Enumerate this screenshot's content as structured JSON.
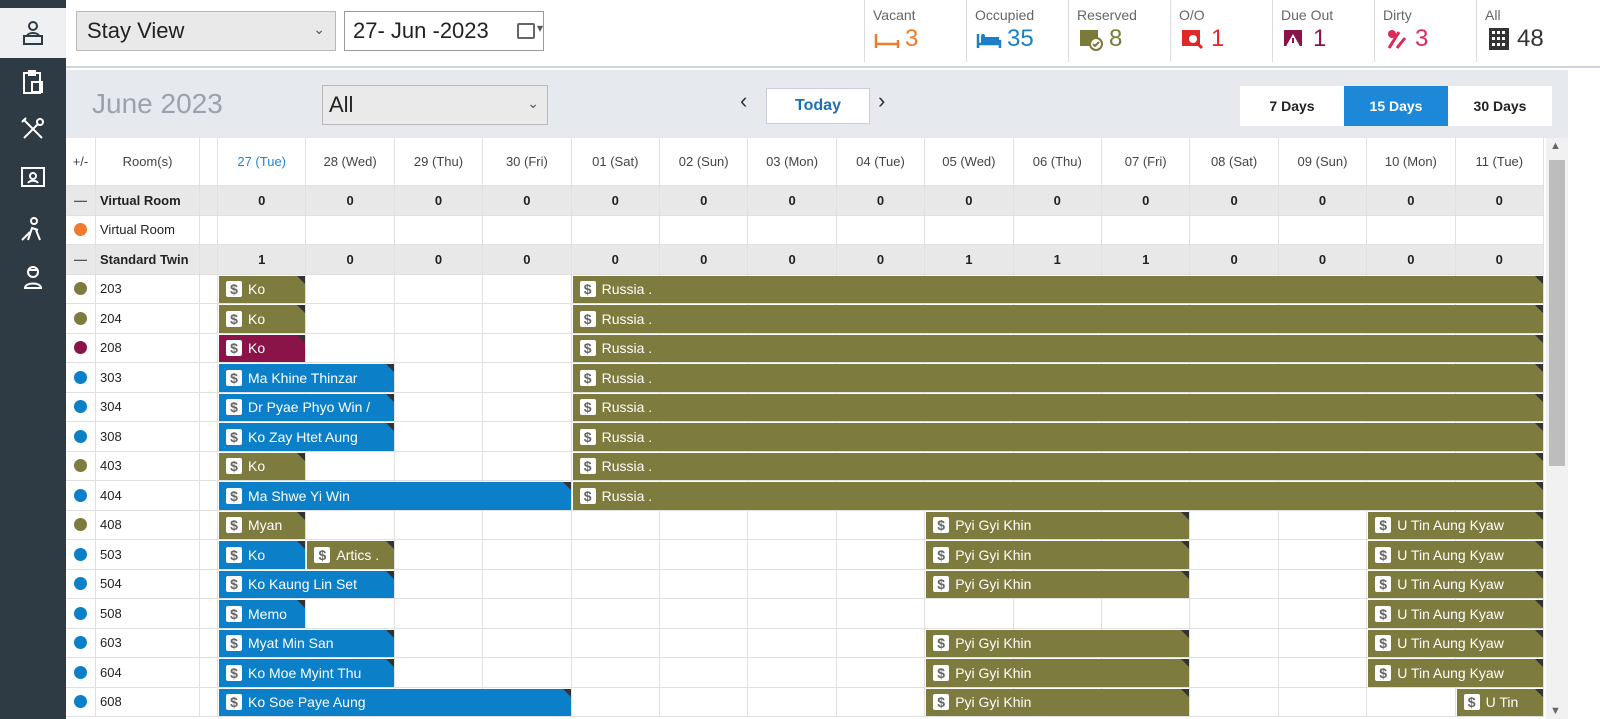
{
  "topbar": {
    "view_select": "Stay View",
    "date": "27- Jun -2023",
    "stats": [
      {
        "key": "vacant",
        "label": "Vacant",
        "value": "3",
        "color": "#f07b2e",
        "icon": "bed-empty-icon"
      },
      {
        "key": "occupied",
        "label": "Occupied",
        "value": "35",
        "color": "#1b80c8",
        "icon": "bed-occupied-icon"
      },
      {
        "key": "reserved",
        "label": "Reserved",
        "value": "8",
        "color": "#7b7a3a",
        "icon": "reserved-check-icon"
      },
      {
        "key": "oo",
        "label": "O/O",
        "value": "1",
        "color": "#e02828",
        "icon": "out-of-order-icon"
      },
      {
        "key": "dueout",
        "label": "Due Out",
        "value": "1",
        "color": "#8a1447",
        "icon": "due-out-icon"
      },
      {
        "key": "dirty",
        "label": "Dirty",
        "value": "3",
        "color": "#e02857",
        "icon": "dirty-icon"
      },
      {
        "key": "all",
        "label": "All",
        "value": "48",
        "color": "#333333",
        "icon": "building-icon"
      }
    ]
  },
  "calendar": {
    "month_label": "June 2023",
    "filter": "All",
    "today_label": "Today",
    "ranges": [
      {
        "label": "7 Days",
        "active": false
      },
      {
        "label": "15 Days",
        "active": true
      },
      {
        "label": "30 Days",
        "active": false
      }
    ]
  },
  "grid": {
    "toggle_header": "+/-",
    "rooms_header": "Room(s)",
    "days": [
      "27 (Tue)",
      "28 (Wed)",
      "29 (Thu)",
      "30 (Fri)",
      "01 (Sat)",
      "02 (Sun)",
      "03 (Mon)",
      "04 (Tue)",
      "05 (Wed)",
      "06 (Thu)",
      "07 (Fri)",
      "08 (Sat)",
      "09 (Sun)",
      "10 (Mon)",
      "11 (Tue)"
    ],
    "rows": [
      {
        "type": "group",
        "label": "Virtual Room",
        "counts": [
          "0",
          "0",
          "0",
          "0",
          "0",
          "0",
          "0",
          "0",
          "0",
          "0",
          "0",
          "0",
          "0",
          "0",
          "0"
        ]
      },
      {
        "type": "room",
        "label": "Virtual Room",
        "dot": "#f07b2e"
      },
      {
        "type": "group",
        "label": "Standard Twin",
        "counts": [
          "1",
          "0",
          "0",
          "0",
          "0",
          "0",
          "0",
          "0",
          "1",
          "1",
          "1",
          "0",
          "0",
          "0",
          "0"
        ]
      },
      {
        "type": "room",
        "label": "203",
        "dot": "#7e7b3e"
      },
      {
        "type": "room",
        "label": "204",
        "dot": "#7e7b3e"
      },
      {
        "type": "room",
        "label": "208",
        "dot": "#8a1447"
      },
      {
        "type": "room",
        "label": "303",
        "dot": "#0b7fc7"
      },
      {
        "type": "room",
        "label": "304",
        "dot": "#0b7fc7"
      },
      {
        "type": "room",
        "label": "308",
        "dot": "#0b7fc7"
      },
      {
        "type": "room",
        "label": "403",
        "dot": "#7e7b3e"
      },
      {
        "type": "room",
        "label": "404",
        "dot": "#0b7fc7"
      },
      {
        "type": "room",
        "label": "408",
        "dot": "#7e7b3e"
      },
      {
        "type": "room",
        "label": "503",
        "dot": "#0b7fc7"
      },
      {
        "type": "room",
        "label": "504",
        "dot": "#0b7fc7"
      },
      {
        "type": "room",
        "label": "508",
        "dot": "#0b7fc7"
      },
      {
        "type": "room",
        "label": "603",
        "dot": "#0b7fc7"
      },
      {
        "type": "room",
        "label": "604",
        "dot": "#0b7fc7"
      },
      {
        "type": "room",
        "label": "608",
        "dot": "#0b7fc7"
      }
    ],
    "bookings": [
      {
        "row": 3,
        "start": 0,
        "span": 1,
        "name": "Ko",
        "status": "olive"
      },
      {
        "row": 3,
        "start": 4,
        "span": 11,
        "name": "Russia .",
        "status": "olive"
      },
      {
        "row": 4,
        "start": 0,
        "span": 1,
        "name": "Ko",
        "status": "olive"
      },
      {
        "row": 4,
        "start": 4,
        "span": 11,
        "name": "Russia .",
        "status": "olive"
      },
      {
        "row": 5,
        "start": 0,
        "span": 1,
        "name": "Ko",
        "status": "maroon"
      },
      {
        "row": 5,
        "start": 4,
        "span": 11,
        "name": "Russia .",
        "status": "olive"
      },
      {
        "row": 6,
        "start": 0,
        "span": 2,
        "name": "Ma Khine Thinzar",
        "status": "blue"
      },
      {
        "row": 6,
        "start": 4,
        "span": 11,
        "name": "Russia .",
        "status": "olive"
      },
      {
        "row": 7,
        "start": 0,
        "span": 2,
        "name": "Dr Pyae Phyo Win /",
        "status": "blue"
      },
      {
        "row": 7,
        "start": 4,
        "span": 11,
        "name": "Russia .",
        "status": "olive"
      },
      {
        "row": 8,
        "start": 0,
        "span": 2,
        "name": "Ko Zay Htet Aung",
        "status": "blue"
      },
      {
        "row": 8,
        "start": 4,
        "span": 11,
        "name": "Russia .",
        "status": "olive"
      },
      {
        "row": 9,
        "start": 0,
        "span": 1,
        "name": "Ko",
        "status": "olive"
      },
      {
        "row": 9,
        "start": 4,
        "span": 11,
        "name": "Russia .",
        "status": "olive"
      },
      {
        "row": 10,
        "start": 0,
        "span": 4,
        "name": "Ma Shwe Yi Win",
        "status": "blue"
      },
      {
        "row": 10,
        "start": 4,
        "span": 11,
        "name": "Russia .",
        "status": "olive"
      },
      {
        "row": 11,
        "start": 0,
        "span": 1,
        "name": "Myan",
        "status": "olive"
      },
      {
        "row": 11,
        "start": 8,
        "span": 3,
        "name": "Pyi Gyi Khin",
        "status": "olive"
      },
      {
        "row": 11,
        "start": 13,
        "span": 2,
        "name": "U Tin Aung Kyaw",
        "status": "olive"
      },
      {
        "row": 12,
        "start": 0,
        "span": 1,
        "name": "Ko",
        "status": "blue"
      },
      {
        "row": 12,
        "start": 1,
        "span": 1,
        "name": "Artics .",
        "status": "olive"
      },
      {
        "row": 12,
        "start": 8,
        "span": 3,
        "name": "Pyi Gyi Khin",
        "status": "olive"
      },
      {
        "row": 12,
        "start": 13,
        "span": 2,
        "name": "U Tin Aung Kyaw",
        "status": "olive"
      },
      {
        "row": 13,
        "start": 0,
        "span": 2,
        "name": "Ko Kaung Lin Set",
        "status": "blue"
      },
      {
        "row": 13,
        "start": 8,
        "span": 3,
        "name": "Pyi Gyi Khin",
        "status": "olive"
      },
      {
        "row": 13,
        "start": 13,
        "span": 2,
        "name": "U Tin Aung Kyaw",
        "status": "olive"
      },
      {
        "row": 14,
        "start": 0,
        "span": 1,
        "name": "Memo",
        "status": "blue"
      },
      {
        "row": 14,
        "start": 13,
        "span": 2,
        "name": "U Tin Aung Kyaw",
        "status": "olive"
      },
      {
        "row": 15,
        "start": 0,
        "span": 2,
        "name": "Myat Min San",
        "status": "blue"
      },
      {
        "row": 15,
        "start": 8,
        "span": 3,
        "name": "Pyi Gyi Khin",
        "status": "olive"
      },
      {
        "row": 15,
        "start": 13,
        "span": 2,
        "name": "U Tin Aung Kyaw",
        "status": "olive"
      },
      {
        "row": 16,
        "start": 0,
        "span": 2,
        "name": "Ko Moe Myint Thu",
        "status": "blue"
      },
      {
        "row": 16,
        "start": 8,
        "span": 3,
        "name": "Pyi Gyi Khin",
        "status": "olive"
      },
      {
        "row": 16,
        "start": 13,
        "span": 2,
        "name": "U Tin Aung Kyaw",
        "status": "olive"
      },
      {
        "row": 17,
        "start": 0,
        "span": 4,
        "name": "Ko Soe Paye Aung",
        "status": "blue"
      },
      {
        "row": 17,
        "start": 8,
        "span": 3,
        "name": "Pyi Gyi Khin",
        "status": "olive"
      },
      {
        "row": 17,
        "start": 14,
        "span": 1,
        "name": "U Tin",
        "status": "olive"
      }
    ]
  }
}
